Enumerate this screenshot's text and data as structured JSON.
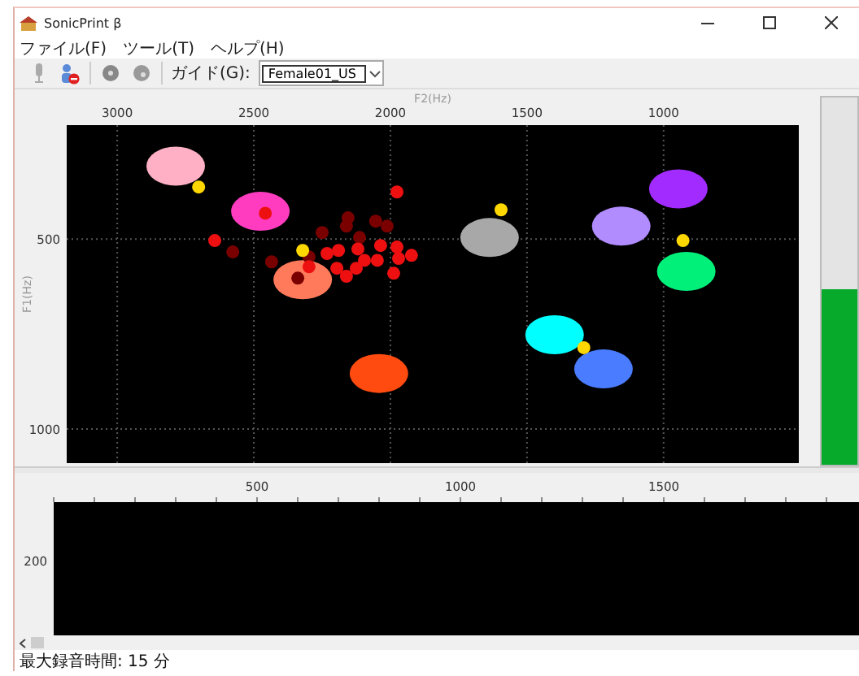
{
  "window": {
    "title": "SonicPrint β"
  },
  "menu": [
    "ファイル(F)",
    "ツール(T)",
    "ヘルプ(H)"
  ],
  "toolbar": {
    "guide_label": "ガイド(G):",
    "guide_value": "Female01_US"
  },
  "formant_chart": {
    "chart_data": {
      "type": "scatter",
      "xlabel": "F2(Hz)",
      "ylabel": "F1(Hz)",
      "xlim": [
        3185,
        505
      ],
      "ylim": [
        1090,
        200
      ],
      "xticks": [
        3000,
        2500,
        2000,
        1500,
        1000
      ],
      "yticks": [
        500,
        1000
      ],
      "grid": true,
      "series": [
        {
          "color": "#ffb0c4",
          "x": [
            2786
          ],
          "values": [
            308
          ]
        },
        {
          "color": "#ff3cc0",
          "x": [
            2476
          ],
          "values": [
            427
          ]
        },
        {
          "color": "#ff7a5a",
          "x": [
            2321
          ],
          "values": [
            607
          ]
        },
        {
          "color": "#ff4a10",
          "x": [
            2042
          ],
          "values": [
            854
          ]
        },
        {
          "color": "#a8a8a8",
          "x": [
            1637
          ],
          "values": [
            496
          ]
        },
        {
          "color": "#b08cff",
          "x": [
            1155
          ],
          "values": [
            466
          ]
        },
        {
          "color": "#a22cff",
          "x": [
            946
          ],
          "values": [
            368
          ]
        },
        {
          "color": "#00f07a",
          "x": [
            917
          ],
          "values": [
            585
          ]
        },
        {
          "color": "#00ffff",
          "x": [
            1399
          ],
          "values": [
            752
          ]
        },
        {
          "color": "#4a7cff",
          "x": [
            1220
          ],
          "values": [
            842
          ]
        },
        {
          "color": "#7a0000",
          "x": [
            2577,
            2435,
            2339,
            2298,
            2250,
            2161,
            2155,
            2113,
            2054,
            2012
          ],
          "values": [
            534,
            560,
            603,
            547,
            483,
            466,
            444,
            496,
            453,
            466
          ]
        },
        {
          "color": "#ee1010",
          "x": [
            1976,
            2643,
            2458,
            2298,
            2232,
            2190,
            2196,
            2161,
            2125,
            2119,
            2095,
            2048,
            2036,
            1988,
            1976,
            1970,
            1923
          ],
          "values": [
            376,
            504,
            432,
            573,
            538,
            530,
            577,
            598,
            577,
            526,
            556,
            556,
            517,
            590,
            521,
            551,
            543
          ]
        },
        {
          "color": "#ffd700",
          "x": [
            2702,
            2321,
            1595,
            929,
            1292
          ],
          "values": [
            363,
            530,
            423,
            504,
            786
          ]
        }
      ]
    }
  },
  "meter": {
    "level": 0.48
  },
  "spectrum_panel": {
    "x_tick_labels": [
      "500",
      "1000",
      "1500"
    ],
    "y_tick_labels": [
      "200"
    ]
  },
  "status_bar": "最大録音時間: 15 分"
}
